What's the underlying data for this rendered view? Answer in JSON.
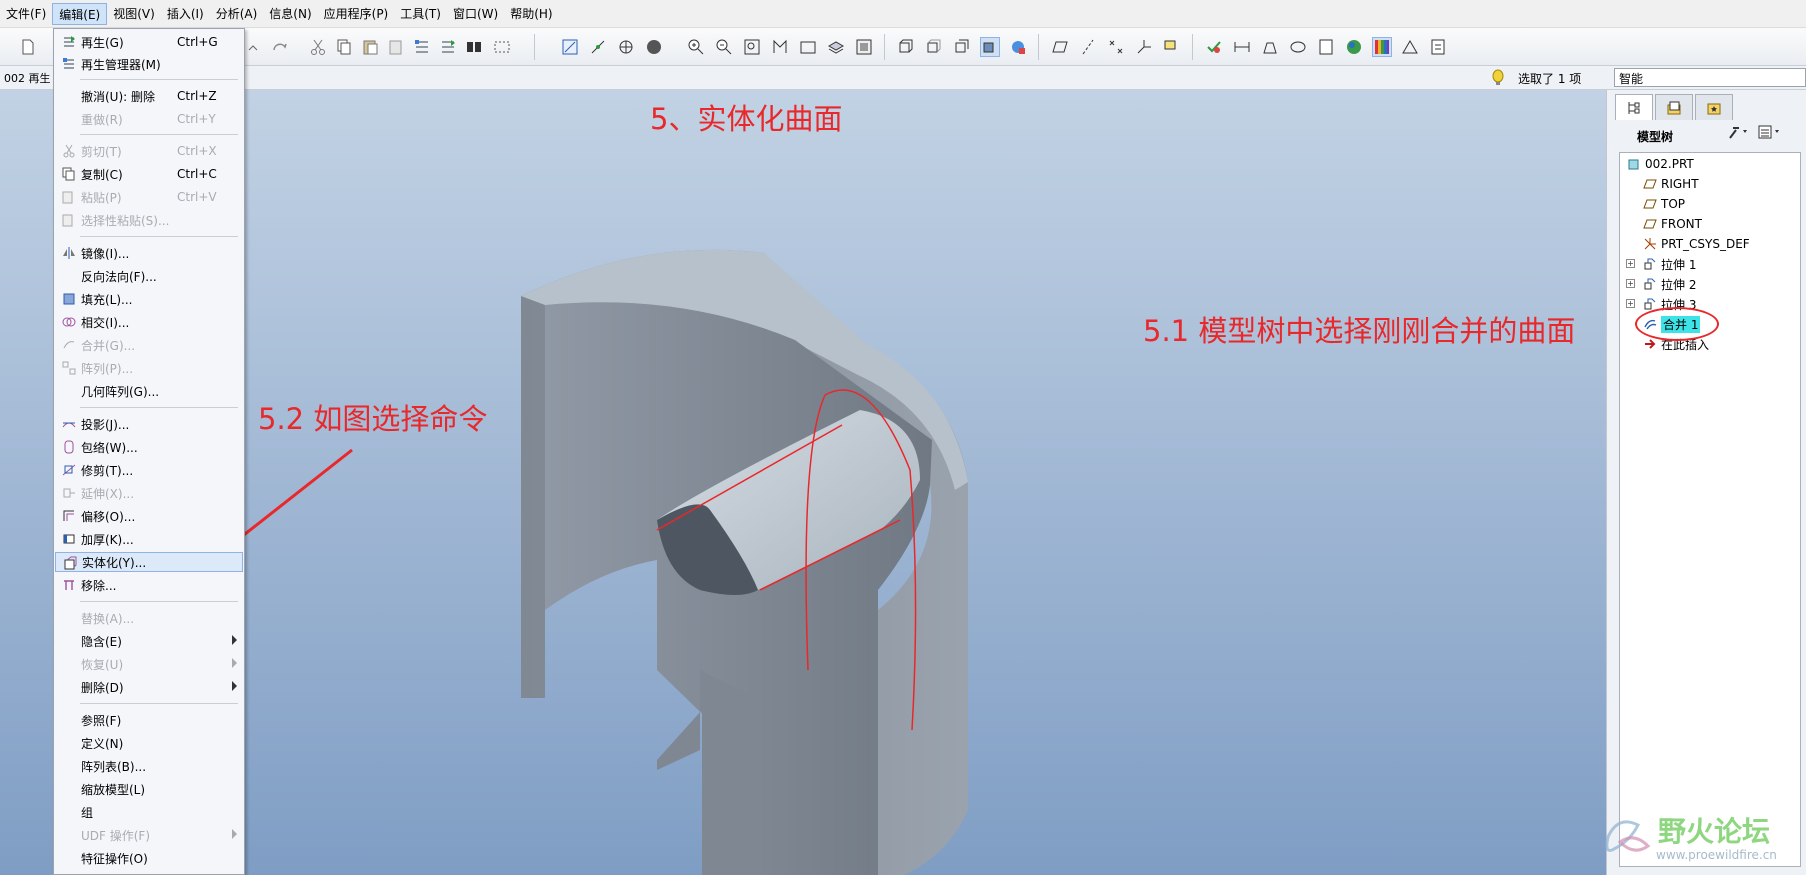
{
  "menubar": [
    "文件(F)",
    "编辑(E)",
    "视图(V)",
    "插入(I)",
    "分析(A)",
    "信息(N)",
    "应用程序(P)",
    "工具(T)",
    "窗口(W)",
    "帮助(H)"
  ],
  "status": {
    "doc_label": "002 再生",
    "selected": "选取了 1 项",
    "filter": "智能"
  },
  "edit_menu": [
    {
      "label": "再生(G)",
      "shortcut": "Ctrl+G",
      "icon": "regenerate-icon"
    },
    {
      "label": "再生管理器(M)",
      "shortcut": "",
      "icon": "regen-manager-icon"
    },
    {
      "sep": true
    },
    {
      "label": "撤消(U): 删除",
      "shortcut": "Ctrl+Z"
    },
    {
      "label": "重做(R)",
      "shortcut": "Ctrl+Y",
      "disabled": true
    },
    {
      "sep": true
    },
    {
      "label": "剪切(T)",
      "shortcut": "Ctrl+X",
      "disabled": true,
      "icon": "cut-icon"
    },
    {
      "label": "复制(C)",
      "shortcut": "Ctrl+C",
      "icon": "copy-icon"
    },
    {
      "label": "粘贴(P)",
      "shortcut": "Ctrl+V",
      "disabled": true,
      "icon": "paste-icon"
    },
    {
      "label": "选择性粘贴(S)...",
      "shortcut": "",
      "disabled": true,
      "icon": "paste-special-icon"
    },
    {
      "sep": true
    },
    {
      "label": "镜像(I)...",
      "icon": "mirror-icon"
    },
    {
      "label": "反向法向(F)..."
    },
    {
      "label": "填充(L)...",
      "icon": "fill-icon"
    },
    {
      "label": "相交(I)...",
      "icon": "intersect-icon"
    },
    {
      "label": "合并(G)...",
      "disabled": true,
      "icon": "merge-icon"
    },
    {
      "label": "阵列(P)...",
      "disabled": true,
      "icon": "pattern-icon"
    },
    {
      "label": "几何阵列(G)..."
    },
    {
      "sep": true
    },
    {
      "label": "投影(J)...",
      "icon": "project-icon"
    },
    {
      "label": "包络(W)...",
      "icon": "wrap-icon"
    },
    {
      "label": "修剪(T)...",
      "icon": "trim-icon"
    },
    {
      "label": "延伸(X)...",
      "disabled": true,
      "icon": "extend-icon"
    },
    {
      "label": "偏移(O)...",
      "icon": "offset-icon"
    },
    {
      "label": "加厚(K)...",
      "icon": "thicken-icon"
    },
    {
      "label": "实体化(Y)...",
      "icon": "solidify-icon",
      "highlight": true
    },
    {
      "label": "移除...",
      "icon": "remove-icon"
    },
    {
      "sep": true
    },
    {
      "label": "替换(A)...",
      "disabled": true
    },
    {
      "label": "隐含(E)",
      "submenu": true
    },
    {
      "label": "恢复(U)",
      "submenu": true,
      "disabled": true
    },
    {
      "label": "删除(D)",
      "submenu": true
    },
    {
      "sep": true
    },
    {
      "label": "参照(F)"
    },
    {
      "label": "定义(N)"
    },
    {
      "label": "阵列表(B)..."
    },
    {
      "label": "缩放模型(L)"
    },
    {
      "label": "组"
    },
    {
      "label": "UDF 操作(F)",
      "submenu": true,
      "disabled": true
    },
    {
      "label": "特征操作(O)"
    }
  ],
  "annotations": {
    "title": "5、实体化曲面",
    "step_51": "5.1 模型树中选择刚刚合并的曲面",
    "step_52": "5.2 如图选择命令"
  },
  "model_tree": {
    "title": "模型树",
    "items": [
      {
        "label": "002.PRT",
        "icon": "part-icon",
        "indent": 0
      },
      {
        "label": "RIGHT",
        "icon": "datum-plane-icon",
        "indent": 1
      },
      {
        "label": "TOP",
        "icon": "datum-plane-icon",
        "indent": 1
      },
      {
        "label": "FRONT",
        "icon": "datum-plane-icon",
        "indent": 1
      },
      {
        "label": "PRT_CSYS_DEF",
        "icon": "csys-icon",
        "indent": 1
      },
      {
        "label": "拉伸 1",
        "icon": "extrude-icon",
        "indent": 1,
        "expand": true
      },
      {
        "label": "拉伸 2",
        "icon": "extrude-icon",
        "indent": 1,
        "expand": true
      },
      {
        "label": "拉伸 3",
        "icon": "extrude-icon",
        "indent": 1,
        "expand": true
      },
      {
        "label": "合并 1",
        "icon": "merge-feature-icon",
        "indent": 1,
        "selected": true
      },
      {
        "label": "在此插入",
        "icon": "insert-here-icon",
        "indent": 1
      }
    ]
  },
  "watermark": {
    "title": "野火论坛",
    "url": "www.proewildfire.cn"
  },
  "colors": {
    "annotation": "#e8282a",
    "highlight": "#3ee3e8"
  }
}
